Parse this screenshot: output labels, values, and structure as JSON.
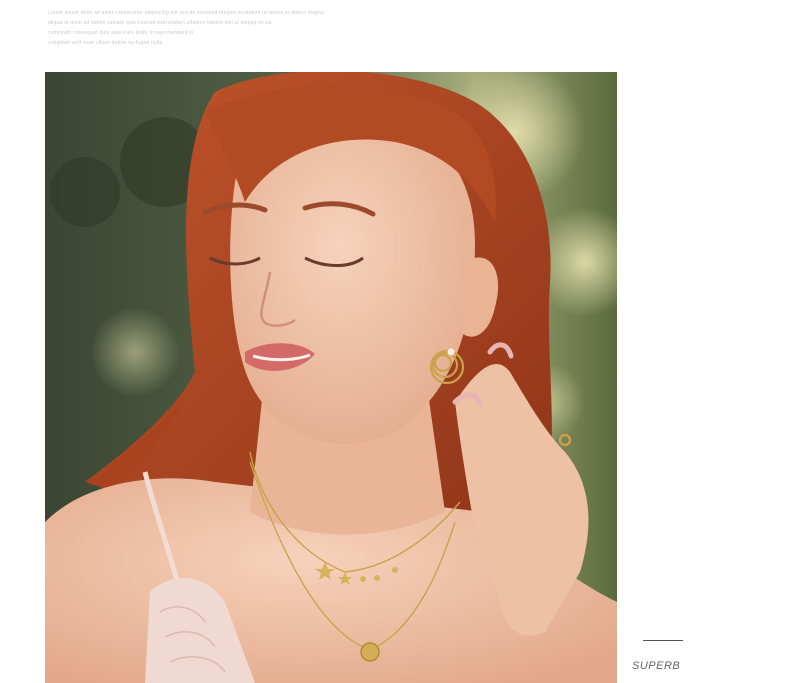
{
  "header": {
    "lines": [
      "Lorem ipsum dolor sit amet consectetur adipiscing elit sed do eiusmod tempor incididunt ut labore et dolore magna",
      "aliqua ut enim ad minim veniam quis nostrud exercitation ullamco laboris nisi ut aliquip ex ea",
      "commodo consequat duis aute irure dolor in reprehenderit in",
      "voluptate velit esse cillum dolore eu fugiat nulla"
    ]
  },
  "photo": {
    "subject": "model-portrait",
    "colors": {
      "background_dark": "#3c4a2e",
      "background_light": "#b8c08a",
      "hair": "#b54a26",
      "skin": "#f0c2a6",
      "gold": "#c9a24a",
      "lace": "#efd9d0"
    }
  },
  "footer": {
    "brand": "SUPERB"
  }
}
